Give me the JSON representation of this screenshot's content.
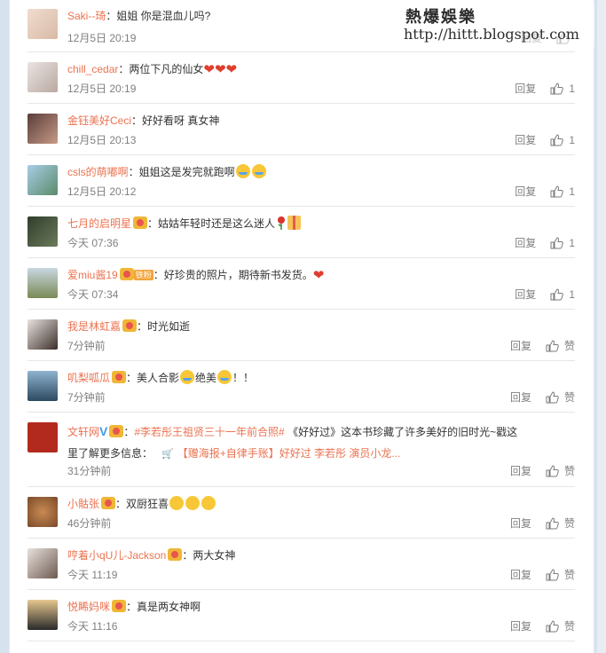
{
  "watermark": {
    "title": "熱爆娛樂",
    "url": "http://hittt.blogspot.com"
  },
  "actions": {
    "reply": "回复",
    "like": "赞"
  },
  "comments": [
    {
      "user": "Saki--琦",
      "text": "：姐姐 你是混血儿吗?",
      "time": "12月5日 20:19",
      "likes": ""
    },
    {
      "user": "chill_cedar",
      "text": "：两位下凡的仙女",
      "time": "12月5日 20:19",
      "likes": "1"
    },
    {
      "user": "金钰美好Ceci",
      "text": "：好好看呀 真女神",
      "time": "12月5日 20:13",
      "likes": "1"
    },
    {
      "user": "csls的萌嘟啊",
      "text": "：姐姐这是发完就跑啊",
      "time": "12月5日 20:12",
      "likes": "1"
    },
    {
      "user": "七月的启明星",
      "text": "：姑姑年轻时还是这么迷人",
      "time": "今天 07:36",
      "likes": "1"
    },
    {
      "user": "爱miu酱19",
      "tag": "铁粉",
      "text": "：好珍贵的照片，期待新书发货。",
      "time": "今天 07:34",
      "likes": "1"
    },
    {
      "user": "我是林虹嘉",
      "text": "：时光如逝",
      "time": "7分钟前",
      "likes": "赞"
    },
    {
      "user": "叽梨呱瓜",
      "text_a": "：美人合影",
      "text_b": "绝美",
      "text_c": "！！",
      "time": "7分钟前",
      "likes": "赞"
    },
    {
      "user": "文轩网",
      "topic": "#李若彤王祖贤三十一年前合照#",
      "text_a": " 《好好过》这本书珍藏了许多美好的旧时光~戳这",
      "text_b": "里了解更多信息：",
      "link": "【赠海报+自律手账】好好过 李若彤 演员小龙...",
      "time": "31分钟前",
      "likes": "赞"
    },
    {
      "user": "小骷张",
      "text": "：双厨狂喜",
      "time": "46分钟前",
      "likes": "赞"
    },
    {
      "user": "哼着小qU儿-Jackson",
      "text": "：两大女神",
      "time": "今天 11:19",
      "likes": "赞"
    },
    {
      "user": "悦睎妈咪",
      "text": "：真是两女神啊",
      "time": "今天 11:16",
      "likes": "赞"
    }
  ]
}
